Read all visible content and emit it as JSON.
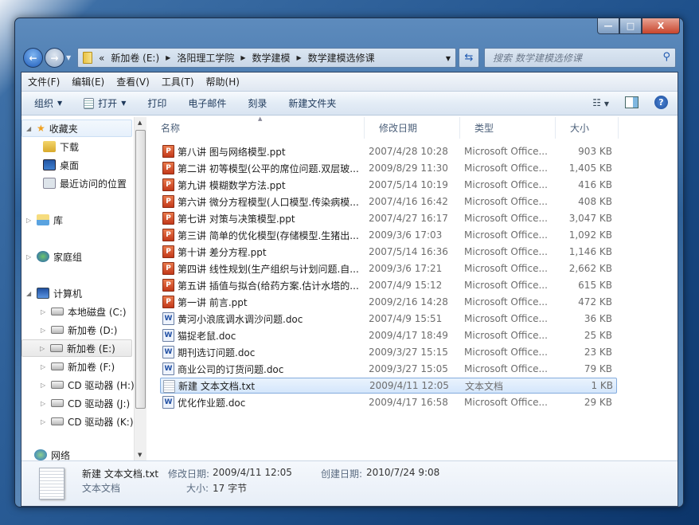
{
  "window": {
    "caption_buttons": {
      "minimize": "—",
      "maximize": "□",
      "close": "X"
    }
  },
  "address": {
    "overflow": "«",
    "crumbs": [
      "新加卷 (E:)",
      "洛阳理工学院",
      "数学建模",
      "数学建模选修课"
    ],
    "search_placeholder": "搜索 数学建模选修课"
  },
  "menu": [
    "文件(F)",
    "编辑(E)",
    "查看(V)",
    "工具(T)",
    "帮助(H)"
  ],
  "toolbar": {
    "organize": "组织",
    "open": "打开",
    "print": "打印",
    "email": "电子邮件",
    "burn": "刻录",
    "new_folder": "新建文件夹"
  },
  "nav": {
    "favorites": "收藏夹",
    "downloads": "下载",
    "desktop": "桌面",
    "recent": "最近访问的位置",
    "libraries": "库",
    "homegroup": "家庭组",
    "computer": "计算机",
    "drives": [
      "本地磁盘 (C:)",
      "新加卷 (D:)",
      "新加卷 (E:)",
      "新加卷 (F:)",
      "CD 驱动器 (H:)",
      "CD 驱动器 (J:)",
      "CD 驱动器 (K:)"
    ],
    "network": "网络",
    "selected_drive": "新加卷 (E:)"
  },
  "columns": {
    "name": "名称",
    "date": "修改日期",
    "type": "类型",
    "size": "大小"
  },
  "files": [
    {
      "name": "第八讲 图与网络模型.ppt",
      "date": "2007/4/28 10:28",
      "type": "Microsoft Office...",
      "size": "903 KB",
      "icon": "ppt"
    },
    {
      "name": "第二讲 初等模型(公平的席位问题.双层玻...",
      "date": "2009/8/29 11:30",
      "type": "Microsoft Office...",
      "size": "1,405 KB",
      "icon": "ppt"
    },
    {
      "name": "第九讲 模糊数学方法.ppt",
      "date": "2007/5/14 10:19",
      "type": "Microsoft Office...",
      "size": "416 KB",
      "icon": "ppt"
    },
    {
      "name": "第六讲 微分方程模型(人口模型.传染病模...",
      "date": "2007/4/16 16:42",
      "type": "Microsoft Office...",
      "size": "408 KB",
      "icon": "ppt"
    },
    {
      "name": "第七讲 对策与决策模型.ppt",
      "date": "2007/4/27 16:17",
      "type": "Microsoft Office...",
      "size": "3,047 KB",
      "icon": "ppt"
    },
    {
      "name": "第三讲 简单的优化模型(存储模型.生猪出...",
      "date": "2009/3/6 17:03",
      "type": "Microsoft Office...",
      "size": "1,092 KB",
      "icon": "ppt"
    },
    {
      "name": "第十讲 差分方程.ppt",
      "date": "2007/5/14 16:36",
      "type": "Microsoft Office...",
      "size": "1,146 KB",
      "icon": "ppt"
    },
    {
      "name": "第四讲 线性规划(生产组织与计划问题.自...",
      "date": "2009/3/6 17:21",
      "type": "Microsoft Office...",
      "size": "2,662 KB",
      "icon": "ppt"
    },
    {
      "name": "第五讲 插值与拟合(给药方案.估计水塔的...",
      "date": "2007/4/9 15:12",
      "type": "Microsoft Office...",
      "size": "615 KB",
      "icon": "ppt"
    },
    {
      "name": "第一讲 前言.ppt",
      "date": "2009/2/16 14:28",
      "type": "Microsoft Office...",
      "size": "472 KB",
      "icon": "ppt"
    },
    {
      "name": "黄河小浪底调水调沙问题.doc",
      "date": "2007/4/9 15:51",
      "type": "Microsoft Office...",
      "size": "36 KB",
      "icon": "doc"
    },
    {
      "name": "猫捉老鼠.doc",
      "date": "2009/4/17 18:49",
      "type": "Microsoft Office...",
      "size": "25 KB",
      "icon": "doc"
    },
    {
      "name": "期刊选订问题.doc",
      "date": "2009/3/27 15:15",
      "type": "Microsoft Office...",
      "size": "23 KB",
      "icon": "doc"
    },
    {
      "name": "商业公司的订货问题.doc",
      "date": "2009/3/27 15:05",
      "type": "Microsoft Office...",
      "size": "79 KB",
      "icon": "doc"
    },
    {
      "name": "新建 文本文档.txt",
      "date": "2009/4/11 12:05",
      "type": "文本文档",
      "size": "1 KB",
      "icon": "txt",
      "selected": true
    },
    {
      "name": "优化作业题.doc",
      "date": "2009/4/17 16:58",
      "type": "Microsoft Office...",
      "size": "29 KB",
      "icon": "doc"
    }
  ],
  "details": {
    "filename": "新建 文本文档.txt",
    "filetype": "文本文档",
    "modified_label": "修改日期:",
    "modified": "2009/4/11 12:05",
    "created_label": "创建日期:",
    "created": "2010/7/24 9:08",
    "size_label": "大小:",
    "size": "17 字节"
  }
}
